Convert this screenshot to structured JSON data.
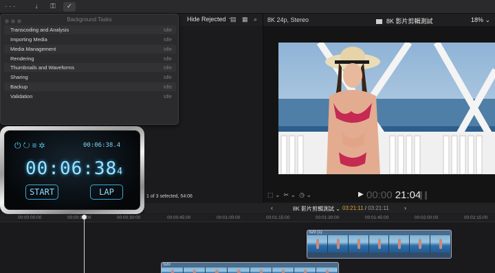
{
  "toolbar": {
    "icons": [
      "download-icon",
      "key-icon",
      "checkmark-icon"
    ]
  },
  "browser": {
    "filter_label": "Hide Rejected",
    "status": "1 of 3 selected, 54:06"
  },
  "background_tasks": {
    "title": "Background Tasks",
    "tasks": [
      {
        "name": "Transcoding and Analysis",
        "status": "Idle"
      },
      {
        "name": "Importing Media",
        "status": "Idle"
      },
      {
        "name": "Media Management",
        "status": "Idle"
      },
      {
        "name": "Rendering",
        "status": "Idle"
      },
      {
        "name": "Thumbnails and Waveforms",
        "status": "Idle"
      },
      {
        "name": "Sharing",
        "status": "Idle"
      },
      {
        "name": "Backup",
        "status": "Idle"
      },
      {
        "name": "Validation",
        "status": "Idle"
      }
    ]
  },
  "viewer": {
    "format": "8K 24p, Stereo",
    "project_title": "8K 影片剪輯測試",
    "zoom": "18%",
    "timecode_dim": "00:00",
    "timecode_lit": "21:04"
  },
  "stopwatch": {
    "small_time": "00:06:38.4",
    "big_time": "00:06:38",
    "big_fraction": "4",
    "start_label": "START",
    "lap_label": "LAP"
  },
  "timeline": {
    "project_name": "8K 影片剪輯測試",
    "current_tc": "03:21:11",
    "duration_tc": "03:21:11",
    "ruler_ticks": [
      "00:00:00:00",
      "00:00:15:00",
      "00:00:30:00",
      "00:00:45:00",
      "00:01:00:00",
      "00:01:15:00",
      "00:01:30:00",
      "00:01:45:00",
      "00:02:00:00",
      "00:02:15:00"
    ],
    "clips": [
      {
        "label": "S20 (1)"
      },
      {
        "label": "S20"
      }
    ]
  },
  "colors": {
    "accent_orange": "#e0a030",
    "stopwatch_cyan": "#9fe3ff",
    "clip_blue": "#4a6c8c"
  }
}
